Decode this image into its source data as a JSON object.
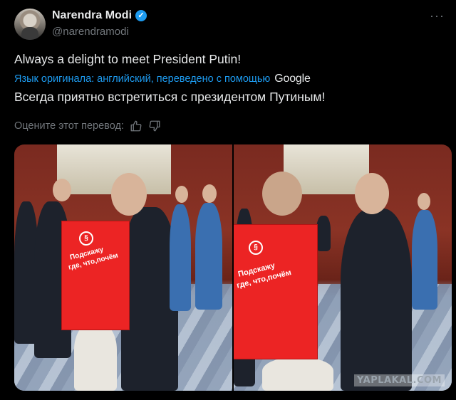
{
  "author": {
    "display_name": "Narendra Modi",
    "handle": "@narendramodi",
    "verified_icon": "verified-badge-icon"
  },
  "more_icon": "more-options-icon",
  "tweet": {
    "text": "Always a delight to meet President Putin!",
    "translation_label": "Язык оригинала: английский, переведено с помощью",
    "translation_provider": "Google",
    "translated_text": "Всегда приятно встретиться с президентом Путиным!",
    "rate_translation_label": "Оцените этот перевод:"
  },
  "media": {
    "vest_logo": "§",
    "vest_text_line1": "Подскажу",
    "vest_text_line2": "где, что,почём",
    "watermark": "YAPLAKAL.COM"
  },
  "colors": {
    "accent": "#1d9bf0",
    "background": "#000000",
    "text_primary": "#e7e9ea",
    "text_secondary": "#71767b",
    "vest_red": "#ec2424"
  }
}
